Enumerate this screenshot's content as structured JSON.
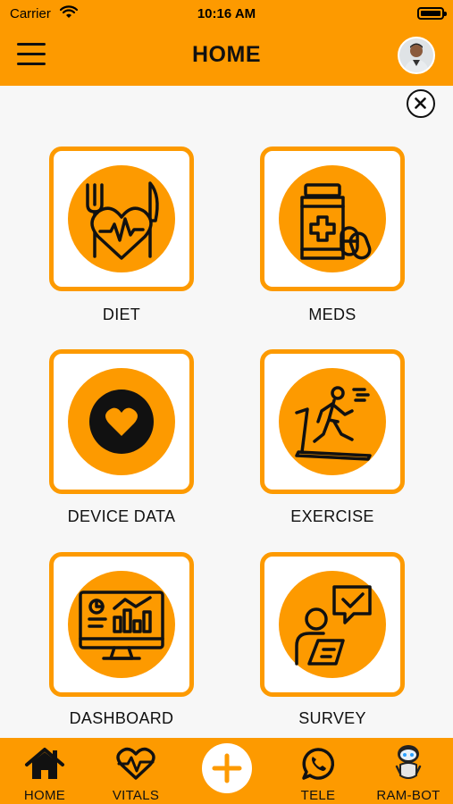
{
  "status_bar": {
    "carrier": "Carrier",
    "time": "10:16 AM"
  },
  "header": {
    "title": "HOME"
  },
  "colors": {
    "accent": "#fd9a00",
    "background": "#f7f7f7",
    "icon_dark": "#111111"
  },
  "tiles": [
    {
      "label": "DIET",
      "icon": "diet-heart-cutlery-icon"
    },
    {
      "label": "MEDS",
      "icon": "medicine-bottle-pills-icon"
    },
    {
      "label": "DEVICE DATA",
      "icon": "heart-badge-icon"
    },
    {
      "label": "EXERCISE",
      "icon": "treadmill-runner-icon"
    },
    {
      "label": "DASHBOARD",
      "icon": "dashboard-monitor-icon"
    },
    {
      "label": "SURVEY",
      "icon": "survey-chat-icon"
    }
  ],
  "bottom_nav": [
    {
      "label": "HOME",
      "icon": "home-icon"
    },
    {
      "label": "VITALS",
      "icon": "heart-pulse-icon"
    },
    {
      "label": "TELE",
      "icon": "whatsapp-phone-icon"
    },
    {
      "label": "RAM-BOT",
      "icon": "robot-icon"
    }
  ],
  "fab": {
    "icon": "plus-icon"
  }
}
